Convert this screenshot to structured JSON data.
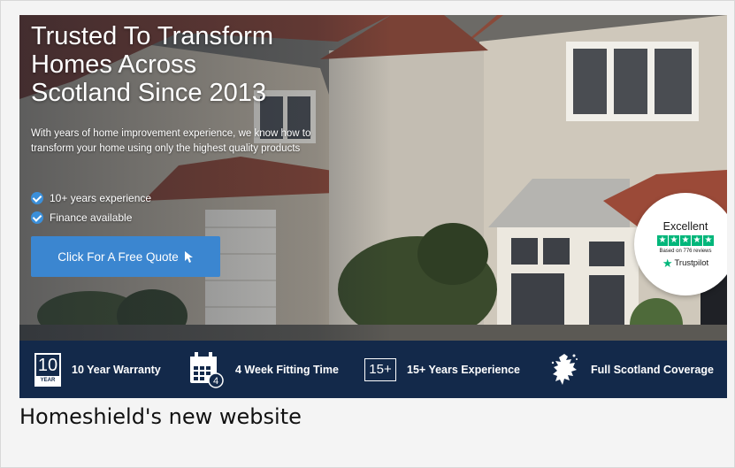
{
  "hero": {
    "headline_line1": "Trusted To Transform",
    "headline_line2": "Homes Across",
    "headline_line3": "Scotland Since 2013",
    "intro": "With years of home improvement experience, we know how to transform your home using only the highest quality products",
    "features": [
      "10+ years experience",
      "Finance available"
    ],
    "cta_label": "Click For A Free Quote"
  },
  "trustpilot": {
    "rating": "Excellent",
    "stars": "★",
    "reviews": "Based on 776 reviews",
    "brand": "Trustpilot"
  },
  "feature_bar": {
    "items": [
      {
        "icon": "warranty-10-year-icon",
        "icon_number": "10",
        "icon_caption": "YEAR",
        "label": "10 Year Warranty"
      },
      {
        "icon": "calendar-icon",
        "icon_number": "4",
        "label": "4 Week Fitting Time"
      },
      {
        "icon": "years-15-plus-icon",
        "icon_number": "15+",
        "label": "15+ Years Experience"
      },
      {
        "icon": "scotland-map-icon",
        "label": "Full Scotland Coverage"
      }
    ]
  },
  "caption": "Homeshield's new website",
  "colors": {
    "accent": "#3b86d0",
    "navy": "#13294a",
    "trustpilot_green": "#00b67a"
  }
}
